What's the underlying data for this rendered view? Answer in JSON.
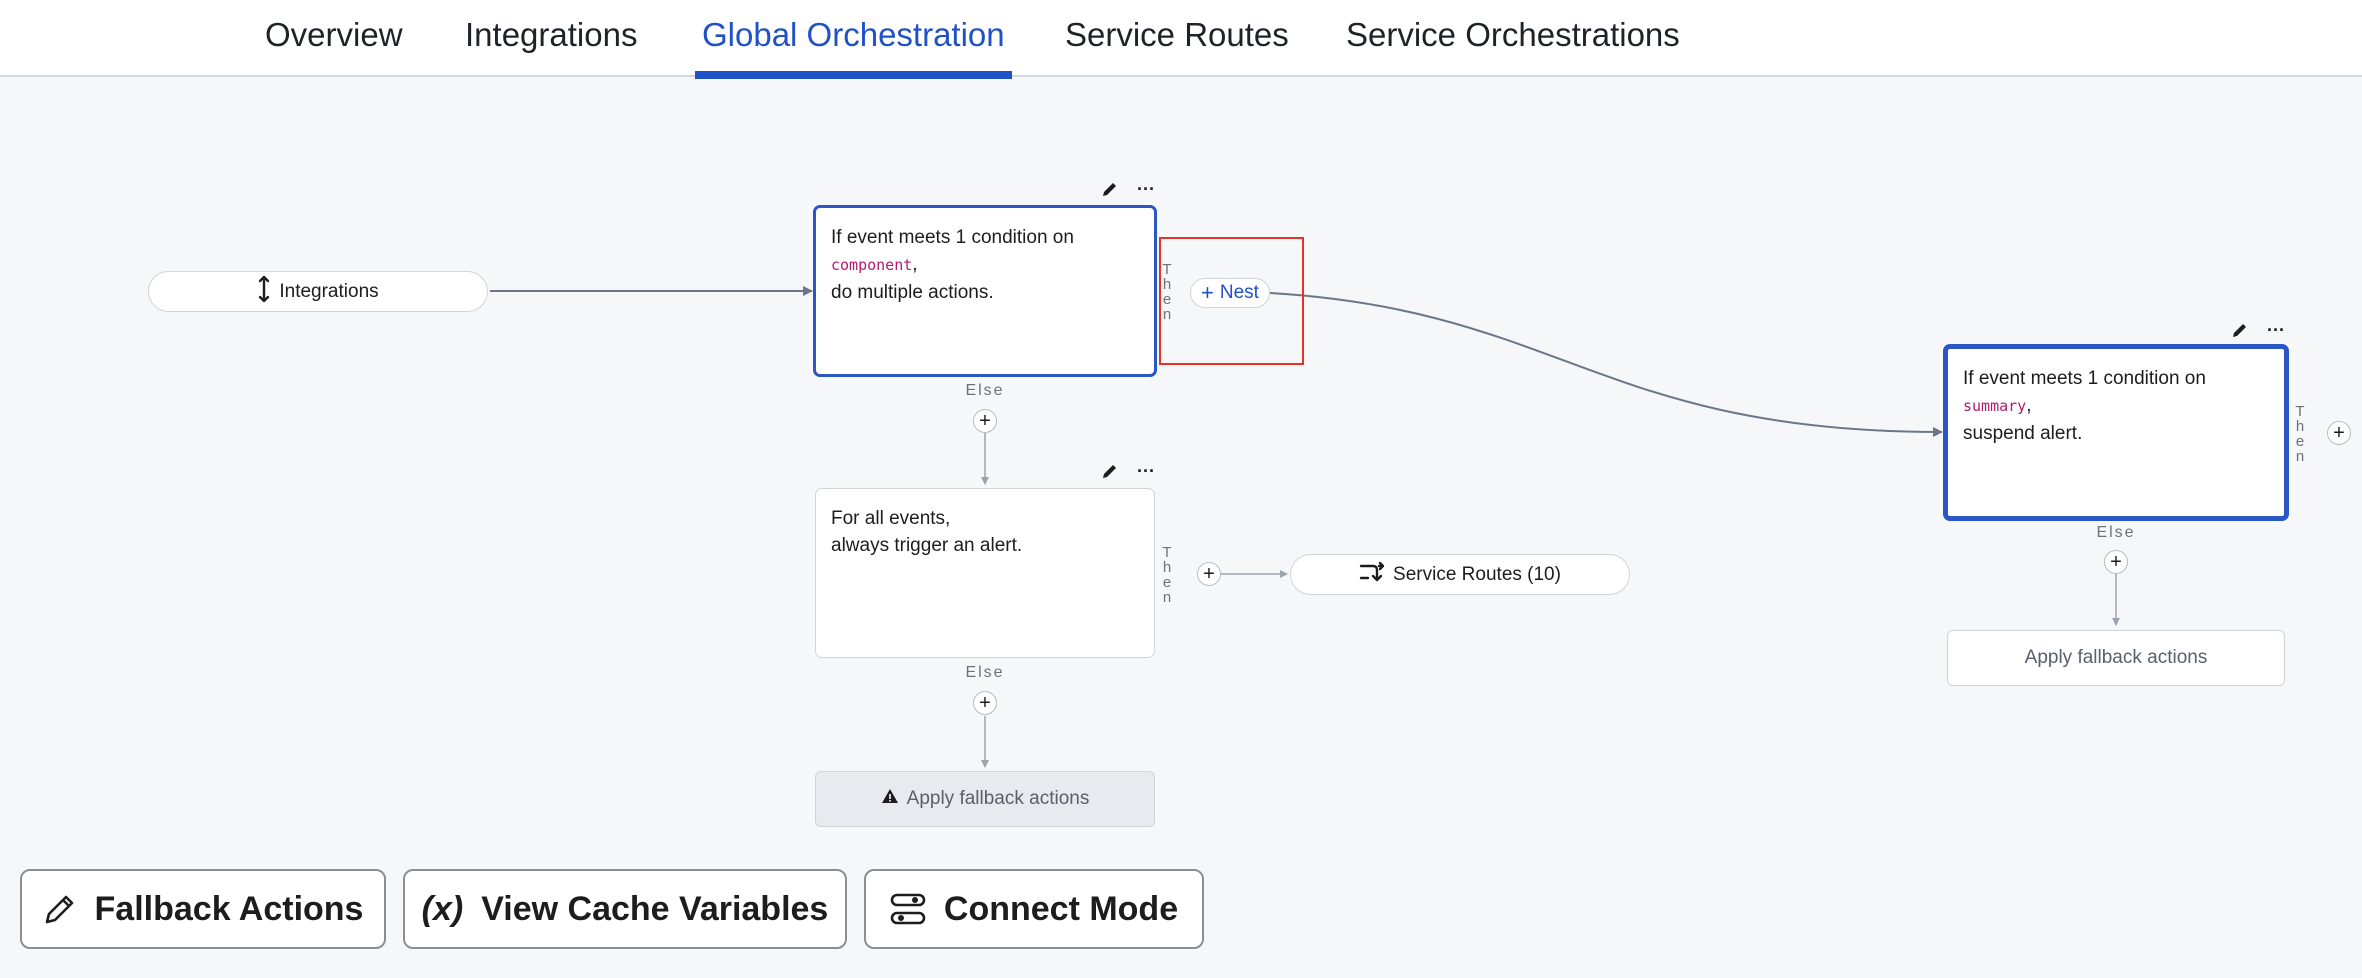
{
  "tabs": [
    {
      "label": "Overview"
    },
    {
      "label": "Integrations"
    },
    {
      "label": "Global Orchestration"
    },
    {
      "label": "Service Routes"
    },
    {
      "label": "Service Orchestrations"
    }
  ],
  "active_tab": "Global Orchestration",
  "canvas": {
    "integrations_pill": "Integrations",
    "rule1": {
      "line1": "If event meets 1 condition on",
      "field": "component",
      "field_suffix": ",",
      "line3": "do multiple actions."
    },
    "rule2": {
      "line1": "For all events,",
      "line2": "always trigger an alert."
    },
    "rule3": {
      "line1": "If event meets 1 condition on",
      "field": "summary",
      "field_suffix": ",",
      "line3": "suspend alert."
    },
    "then_label": "Then",
    "else_label": "Else",
    "nest_button": "Nest",
    "service_routes_pill": "Service Routes (10)",
    "fallback_default": "Apply fallback actions",
    "fallback_nested": "Apply fallback actions",
    "ellipsis": "···"
  },
  "toolbar": {
    "fallback_actions": "Fallback Actions",
    "view_cache_variables_icon": "(x)",
    "view_cache_variables": "View Cache Variables",
    "connect_mode": "Connect Mode"
  },
  "colors": {
    "accent": "#2151c7",
    "highlight": "#e5322b",
    "code": "#b01b6f",
    "edge": "#6b7789"
  }
}
